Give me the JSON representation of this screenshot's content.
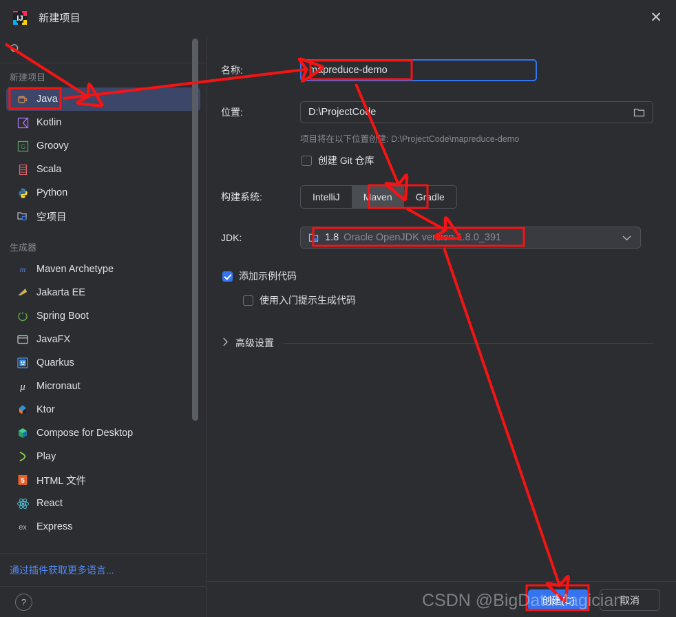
{
  "window": {
    "title": "新建项目",
    "app_icon": "intellij-idea-icon",
    "close_label": "✕"
  },
  "sidebar": {
    "search": {
      "placeholder": "",
      "value": "",
      "icon": "search-icon"
    },
    "group_new_project_label": "新建项目",
    "group_generators_label": "生成器",
    "new_project_items": [
      {
        "label": "Java",
        "icon": "java-coffee-icon",
        "selected": true
      },
      {
        "label": "Kotlin",
        "icon": "kotlin-icon",
        "selected": false
      },
      {
        "label": "Groovy",
        "icon": "groovy-icon",
        "selected": false
      },
      {
        "label": "Scala",
        "icon": "scala-icon",
        "selected": false
      },
      {
        "label": "Python",
        "icon": "python-icon",
        "selected": false
      },
      {
        "label": "空项目",
        "icon": "empty-project-icon",
        "selected": false
      }
    ],
    "generator_items": [
      {
        "label": "Maven Archetype",
        "icon": "maven-icon"
      },
      {
        "label": "Jakarta EE",
        "icon": "jakarta-ee-icon"
      },
      {
        "label": "Spring Boot",
        "icon": "spring-boot-icon"
      },
      {
        "label": "JavaFX",
        "icon": "javafx-icon"
      },
      {
        "label": "Quarkus",
        "icon": "quarkus-icon"
      },
      {
        "label": "Micronaut",
        "icon": "micronaut-icon"
      },
      {
        "label": "Ktor",
        "icon": "ktor-icon"
      },
      {
        "label": "Compose for Desktop",
        "icon": "compose-icon"
      },
      {
        "label": "Play",
        "icon": "play-icon"
      },
      {
        "label": "HTML 文件",
        "icon": "html5-icon"
      },
      {
        "label": "React",
        "icon": "react-icon"
      },
      {
        "label": "Express",
        "icon": "express-icon"
      }
    ],
    "plugins_link": "通过插件获取更多语言...",
    "help_label": "?"
  },
  "form": {
    "name_label": "名称:",
    "name_value": "mapreduce-demo",
    "location_label": "位置:",
    "location_value": "D:\\ProjectCode",
    "browse_icon": "folder-icon",
    "location_hint": "项目将在以下位置创建: D:\\ProjectCode\\mapreduce-demo",
    "git_checkbox_label": "创建 Git 仓库",
    "git_checked": false,
    "build_system_label": "构建系统:",
    "build_systems": [
      {
        "label": "IntelliJ",
        "active": false
      },
      {
        "label": "Maven",
        "active": true
      },
      {
        "label": "Gradle",
        "active": false
      }
    ],
    "jdk_label": "JDK:",
    "jdk_version": "1.8",
    "jdk_vendor": "Oracle OpenJDK version 1.8.0_391",
    "jdk_icon": "jdk-folder-icon",
    "jdk_chevron": "chevron-down-icon",
    "sample_code_label": "添加示例代码",
    "sample_code_checked": true,
    "onboarding_label": "使用入门提示生成代码",
    "onboarding_checked": false,
    "advanced_label": "高级设置",
    "advanced_chevron": "chevron-right-icon"
  },
  "footer": {
    "create_label": "创建(C)",
    "cancel_label": "取消"
  },
  "annotations": {
    "color": "#f41414",
    "highlight_boxes": [
      "java-sidebar-item",
      "name-value",
      "maven-segment",
      "jdk-value",
      "create-button"
    ],
    "watermark": "CSDN @BigDataMagician"
  }
}
